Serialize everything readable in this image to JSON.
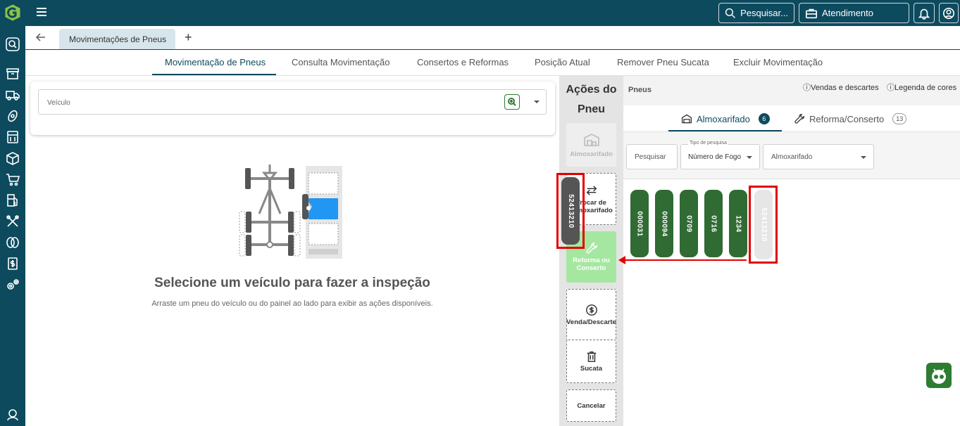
{
  "topbar": {
    "search_label": "Pesquisar...",
    "atendimento_label": "Atendimento"
  },
  "tabbar": {
    "doc_tab": "Movimentações de Pneus",
    "add": "+"
  },
  "nav": {
    "items": [
      "Movimentação de Pneus",
      "Consulta Movimentação",
      "Consertos e Reformas",
      "Posição Atual",
      "Remover Pneu Sucata",
      "Excluir Movimentação"
    ]
  },
  "vehicle": {
    "label": "Veículo"
  },
  "empty_state": {
    "title": "Selecione um veículo para fazer a inspeção",
    "subtitle": "Arraste um pneu do veículo ou do painel ao lado para exibir as ações disponíveis."
  },
  "actions": {
    "title": "Ações do Pneu",
    "almoxarifado": "Almoxarifado",
    "trocar": "Trocar de Almoxarifado",
    "reforma": "Reforma ou Conserto",
    "venda": "Venda/Descarte",
    "sucata": "Sucata",
    "cancelar": "Cancelar"
  },
  "dragging_tire": {
    "number": "52413210"
  },
  "pneus_panel": {
    "title": "Pneus",
    "link_vendas": "Vendas e descartes",
    "link_legenda": "Legenda de cores",
    "tab_almox": "Almoxarifado",
    "tab_almox_count": "6",
    "tab_reforma": "Reforma/Conserto",
    "tab_reforma_count": "13",
    "search_placeholder": "Pesquisar",
    "tipo_label": "Tipo de pesquisa",
    "tipo_value": "Número de Fogo",
    "almox_select": "Almoxarifado",
    "tires": [
      "000031",
      "000094",
      "0709",
      "0716",
      "1234",
      "52413210"
    ]
  },
  "colors": {
    "primary": "#0d4a5e",
    "tire_green": "#2f6b33",
    "highlight_red": "#e00000",
    "reforma_green": "#a5e7a0"
  }
}
